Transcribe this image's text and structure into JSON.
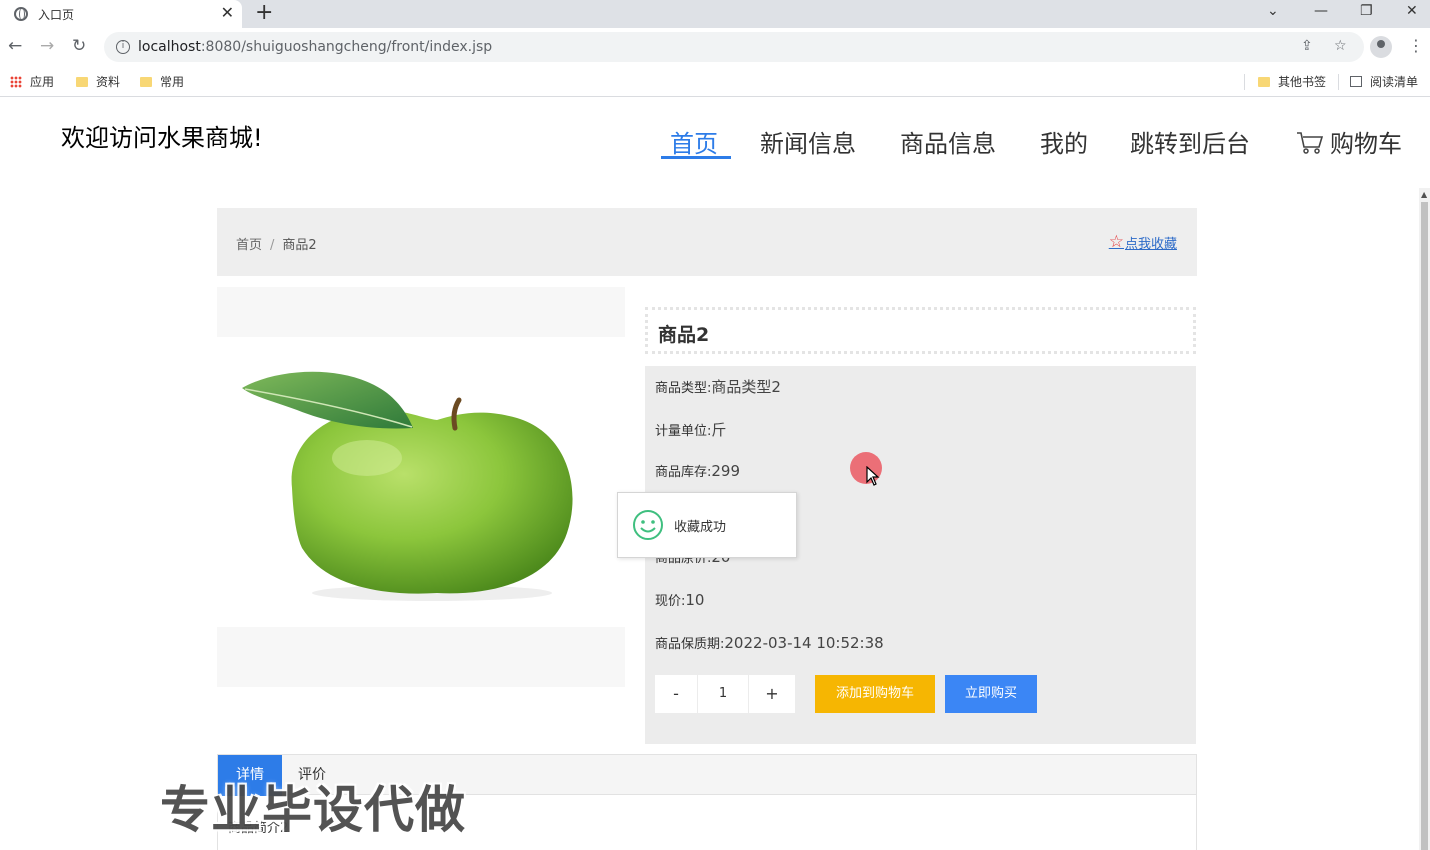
{
  "browser": {
    "tab_title": "入口页",
    "tab_close": "✕",
    "new_tab": "+",
    "url_host": "localhost",
    "url_path": ":8080/shuiguoshangcheng/front/index.jsp",
    "bookmarks": [
      {
        "label": "应用",
        "icon": "apps-grid-icon"
      },
      {
        "label": "资料",
        "icon": "folder-icon"
      },
      {
        "label": "常用",
        "icon": "folder-icon"
      }
    ],
    "other_bookmarks": "其他书签",
    "reading_list": "阅读清单"
  },
  "header": {
    "welcome": "欢迎访问水果商城!",
    "nav": [
      {
        "label": "首页",
        "active": true
      },
      {
        "label": "新闻信息"
      },
      {
        "label": "商品信息"
      },
      {
        "label": "我的"
      },
      {
        "label": "跳转到后台"
      },
      {
        "label": "购物车",
        "icon": "cart-icon"
      }
    ],
    "active_color": "#2d7ce8"
  },
  "breadcrumb": {
    "home": "首页",
    "separator": "/",
    "current": "商品2"
  },
  "favorite": {
    "label": "点我收藏",
    "icon": "star-icon"
  },
  "product": {
    "name": "商品2",
    "image": "green-apple",
    "fields": [
      {
        "label": "商品类型:",
        "value": "商品类型2"
      },
      {
        "label": "计量单位:",
        "value": "斤"
      },
      {
        "label": "商品库存:",
        "value": "299"
      },
      {
        "label": "商品原价:",
        "value": "20"
      },
      {
        "label": "现价:",
        "value": "10"
      },
      {
        "label": "商品保质期:",
        "value": "2022-03-14 10:52:38"
      }
    ],
    "quantity": {
      "minus": "-",
      "value": "1",
      "plus": "+"
    },
    "add_to_cart": "添加到购物车",
    "buy_now": "立即购买",
    "cart_color": "#f6b602",
    "buy_color": "#3b86f5"
  },
  "toast": {
    "message": "收藏成功",
    "icon": "smile-icon"
  },
  "detail_tabs": {
    "tabs": [
      "详情",
      "评价"
    ],
    "content": "商品简介2"
  },
  "watermark": "专业毕设代做"
}
